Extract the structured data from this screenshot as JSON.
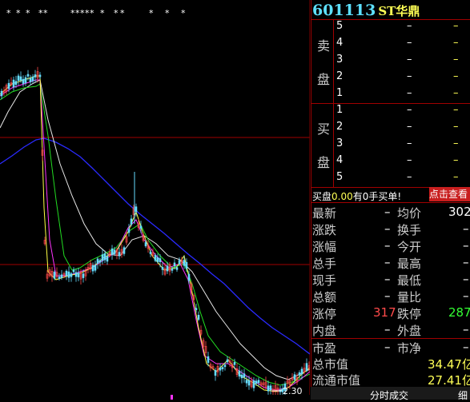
{
  "stock": {
    "code": "601113",
    "name": "ST华鼎"
  },
  "chart": {
    "price_label": "2.30",
    "marks": [
      "*",
      "*",
      "*",
      "*",
      "*",
      "*",
      "*",
      "*",
      "*",
      "*",
      "*",
      "*",
      "*",
      "*",
      "*",
      "*"
    ]
  },
  "orderbook": {
    "sell_label": [
      "卖",
      "盘"
    ],
    "buy_label": [
      "买",
      "盘"
    ],
    "sell": [
      {
        "level": "5",
        "price": "–",
        "vol": "–"
      },
      {
        "level": "4",
        "price": "–",
        "vol": "–"
      },
      {
        "level": "3",
        "price": "–",
        "vol": "–"
      },
      {
        "level": "2",
        "price": "–",
        "vol": "–"
      },
      {
        "level": "1",
        "price": "–",
        "vol": "–"
      }
    ],
    "buy": [
      {
        "level": "1",
        "price": "–",
        "vol": "–"
      },
      {
        "level": "2",
        "price": "–",
        "vol": "–"
      },
      {
        "level": "3",
        "price": "–",
        "vol": "–"
      },
      {
        "level": "4",
        "price": "–",
        "vol": "–"
      },
      {
        "level": "5",
        "price": "–",
        "vol": "–"
      }
    ]
  },
  "notice": {
    "prefix": "买盘",
    "amount": "0.00",
    "suffix": "有0手买单!",
    "button": "点击查看"
  },
  "quotes": {
    "latest_label": "最新",
    "latest": "–",
    "avg_label": "均价",
    "avg": "302",
    "change_label": "涨跌",
    "change": "–",
    "turnover_label": "换手",
    "turnover": "–",
    "pct_label": "涨幅",
    "pct": "–",
    "open_label": "今开",
    "open": "–",
    "total_label": "总手",
    "total": "–",
    "high_label": "最高",
    "high": "–",
    "cur_label": "现手",
    "cur": "–",
    "low_label": "最低",
    "low": "–",
    "amount_label": "总额",
    "amount": "–",
    "ratio_label": "量比",
    "ratio": "–",
    "limit_up_label": "涨停",
    "limit_up": "317",
    "limit_down_label": "跌停",
    "limit_down": "287",
    "inner_label": "内盘",
    "inner": "–",
    "outer_label": "外盘",
    "outer": "–"
  },
  "valuation": {
    "pe_label": "市盈",
    "pe": "–",
    "pb_label": "市净",
    "pb": "–",
    "mcap_label": "总市值",
    "mcap": "34.47亿",
    "float_label": "流通市值",
    "float": "27.41亿"
  },
  "tabs": {
    "tab1": "分时成交",
    "tab2": "细"
  },
  "colors": {
    "up": "#ff4a4a",
    "down": "#33ff33",
    "grid": "#a00000",
    "ma_blue": "#2222ff"
  }
}
